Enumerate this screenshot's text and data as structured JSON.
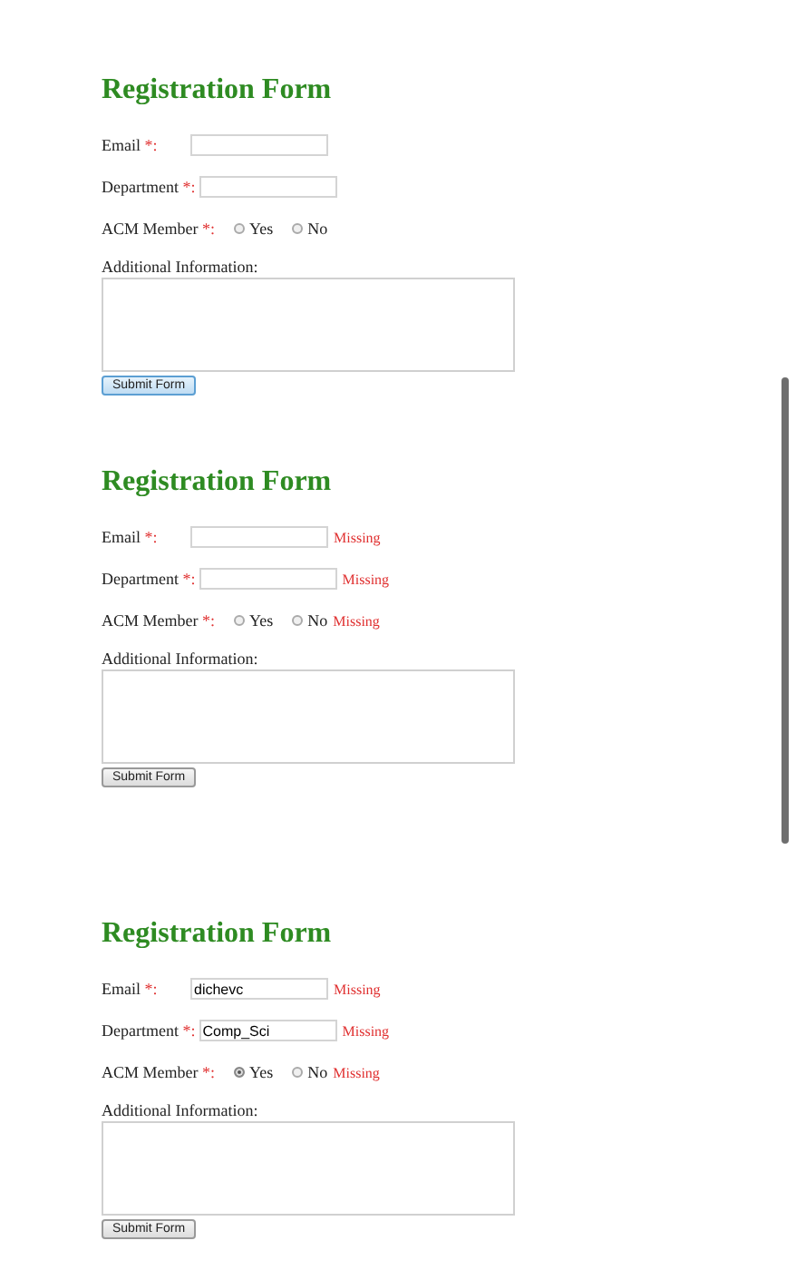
{
  "forms": [
    {
      "title": "Registration Form",
      "fields": [
        {
          "kind": "text",
          "label": "Email ",
          "required_mark": "*:"
        },
        {
          "kind": "text",
          "label": "Department ",
          "required_mark": "*:"
        },
        {
          "kind": "radio",
          "label": "ACM Member ",
          "required_mark": "*:",
          "options": [
            {
              "label": "Yes",
              "selected": false
            },
            {
              "label": "No",
              "selected": false
            }
          ]
        }
      ],
      "notes_label": "Additional Information:",
      "submit": {
        "label": "Submit Form",
        "focused": true
      }
    },
    {
      "title": "Registration Form",
      "fields": [
        {
          "kind": "text",
          "label": "Email ",
          "required_mark": "*:",
          "error": "Missing"
        },
        {
          "kind": "text",
          "label": "Department ",
          "required_mark": "*:",
          "error": "Missing"
        },
        {
          "kind": "radio",
          "label": "ACM Member ",
          "required_mark": "*:",
          "options": [
            {
              "label": "Yes",
              "selected": false
            },
            {
              "label": "No",
              "selected": false
            }
          ],
          "error": "Missing"
        }
      ],
      "notes_label": "Additional Information:",
      "submit": {
        "label": "Submit Form",
        "focused": false
      }
    },
    {
      "title": "Registration Form",
      "fields": [
        {
          "kind": "text",
          "label": "Email ",
          "required_mark": "*:",
          "value": "dichevc",
          "error": "Missing"
        },
        {
          "kind": "text",
          "label": "Department ",
          "required_mark": "*:",
          "value": "Comp_Sci",
          "error": "Missing"
        },
        {
          "kind": "radio",
          "label": "ACM Member ",
          "required_mark": "*:",
          "options": [
            {
              "label": "Yes",
              "selected": true
            },
            {
              "label": "No",
              "selected": false
            }
          ],
          "error": "Missing"
        }
      ],
      "notes_label": "Additional Information:",
      "submit": {
        "label": "Submit Form",
        "focused": false
      }
    }
  ]
}
